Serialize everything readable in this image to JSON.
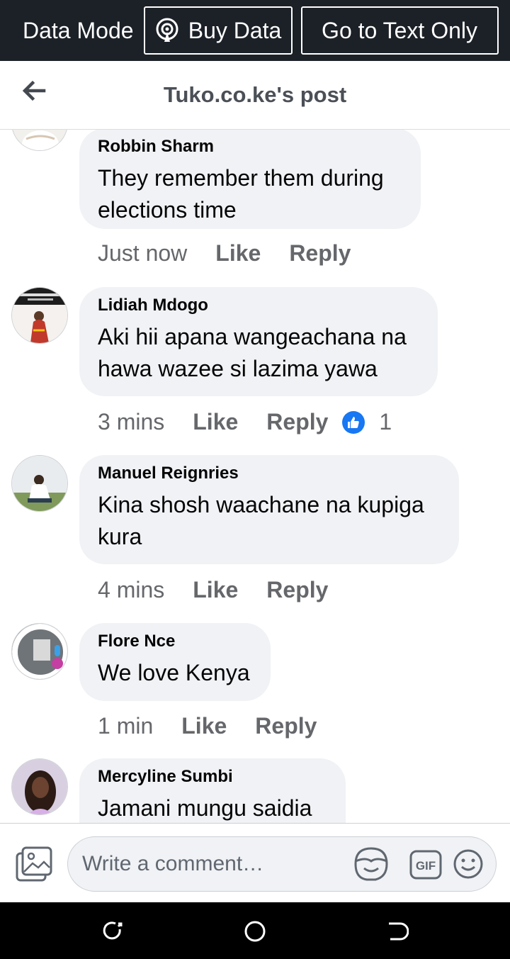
{
  "databar": {
    "mode_label": "Data Mode",
    "buy_label": "Buy Data",
    "text_only_label": "Go to Text Only"
  },
  "header": {
    "title": "Tuko.co.ke's post"
  },
  "comments": [
    {
      "name": "Robbin Sharm",
      "text": "They remember them during elections time",
      "time": "Just now",
      "like": "Like",
      "reply": "Reply"
    },
    {
      "name": "Lidiah Mdogo",
      "text": "Aki hii apana wangeachana na hawa wazee si lazima yawa",
      "time": "3 mins",
      "like": "Like",
      "reply": "Reply",
      "reaction_count": "1"
    },
    {
      "name": "Manuel Reignries",
      "text": "Kina shosh waachane na kupiga kura",
      "time": "4 mins",
      "like": "Like",
      "reply": "Reply"
    },
    {
      "name": "Flore Nce",
      "text": "We love Kenya",
      "time": "1 min",
      "like": "Like",
      "reply": "Reply"
    },
    {
      "name": "Mercyline Sumbi",
      "text": "Jamani mungu saidia",
      "time": "",
      "like": "",
      "reply": ""
    }
  ],
  "composer": {
    "placeholder": "Write a comment…"
  },
  "colors": {
    "databar_bg": "#1c2128",
    "bubble_bg": "#f0f2f5",
    "meta_text": "#65676b",
    "like_reaction": "#1877f2"
  },
  "icons": [
    "back-arrow-icon",
    "broadcast-icon",
    "photo-icon",
    "sticker-icon",
    "gif-icon",
    "emoji-icon",
    "thumbs-up-icon",
    "recent-apps-icon",
    "home-icon",
    "back-icon"
  ]
}
